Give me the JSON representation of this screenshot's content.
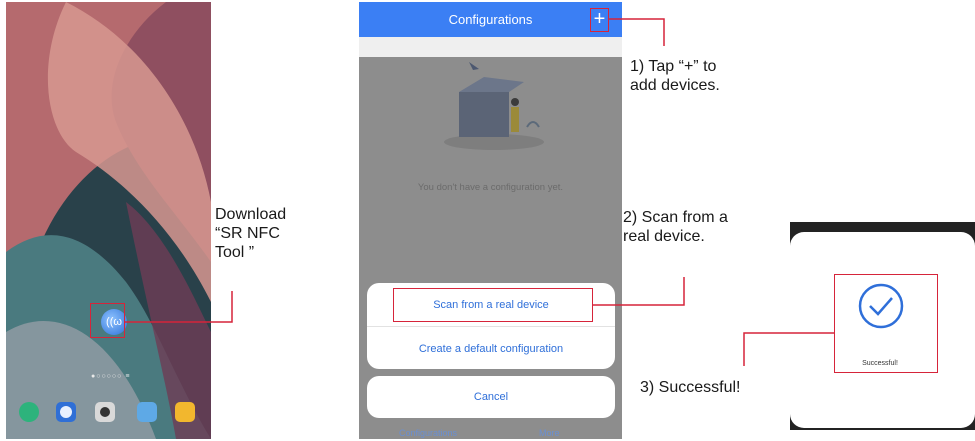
{
  "home_screen": {
    "app_icon": "nfc-app-icon",
    "page_dots": "●○○○○○ ≡",
    "dock_icons": [
      "messages-icon",
      "browser-icon",
      "camera-icon",
      "gallery-icon",
      "folder-icon"
    ]
  },
  "config_app": {
    "header_title": "Configurations",
    "add_button": "+",
    "empty_message": "You don't have a configuration yet.",
    "sheet_options": [
      "Scan from a real device",
      "Create a default configuration"
    ],
    "cancel_label": "Cancel",
    "tabs": [
      "Configurations",
      "More"
    ],
    "accent_color": "#3b7ff4"
  },
  "success_dialog": {
    "message": "Successful!"
  },
  "annotations": {
    "download": [
      "Download",
      "“SR NFC",
      "Tool ”"
    ],
    "step1": [
      "1) Tap “+” to",
      "add devices."
    ],
    "step2": [
      "2) Scan from a",
      "real device."
    ],
    "step3": "3) Successful!"
  },
  "highlight_color": "#d6243a"
}
